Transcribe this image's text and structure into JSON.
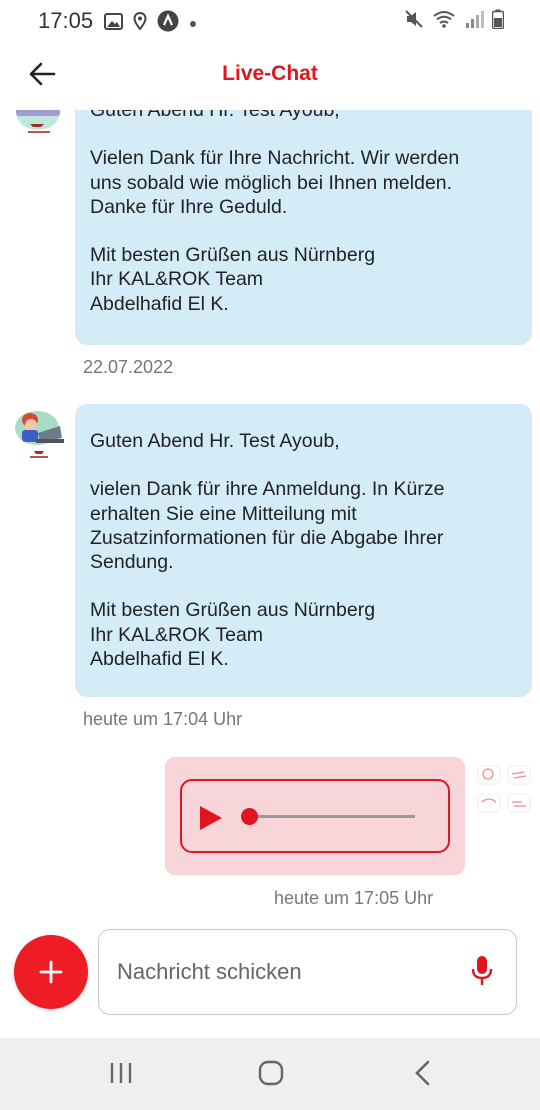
{
  "status_bar": {
    "time": "17:05",
    "left_icons": [
      "image-icon",
      "location-pin-icon",
      "app-notification-icon",
      "dot-icon"
    ],
    "right_icons": [
      "mute-icon",
      "wifi-icon",
      "signal-icon",
      "battery-icon"
    ]
  },
  "header": {
    "title": "Live-Chat",
    "back_icon": "arrow-left-icon"
  },
  "messages": [
    {
      "direction": "incoming",
      "lines": [
        "Guten Abend Hr. Test Ayoub,",
        "",
        "Vielen Dank für Ihre Nachricht. Wir werden",
        "uns sobald wie möglich bei Ihnen melden.",
        "Danke für Ihre Geduld.",
        "",
        "Mit besten Grüßen aus Nürnberg",
        "Ihr KAL&ROK Team",
        "Abdelhafid El K."
      ],
      "timestamp": "22.07.2022"
    },
    {
      "direction": "incoming",
      "lines": [
        "Guten Abend Hr. Test Ayoub,",
        "",
        "vielen Dank für ihre Anmeldung. In Kürze",
        "erhalten Sie eine Mitteilung mit",
        "Zusatzinformationen für die Abgabe Ihrer",
        "Sendung.",
        "",
        "Mit besten Grüßen aus Nürnberg",
        "Ihr KAL&ROK Team",
        "Abdelhafid El K."
      ],
      "timestamp": "heute um 17:04 Uhr"
    },
    {
      "direction": "outgoing",
      "type": "audio",
      "progress": 0,
      "timestamp": "heute um 17:05 Uhr"
    }
  ],
  "composer": {
    "placeholder": "Nachricht schicken",
    "value": "",
    "add_icon": "plus-icon",
    "mic_icon": "microphone-icon"
  },
  "nav_bar": {
    "icons": [
      "recent-apps-icon",
      "home-icon",
      "back-icon"
    ]
  },
  "colors": {
    "accent": "#e0161f",
    "incoming_bubble": "#d3ecf8",
    "outgoing_bubble": "#f8d5d8",
    "timestamp": "#777777"
  }
}
